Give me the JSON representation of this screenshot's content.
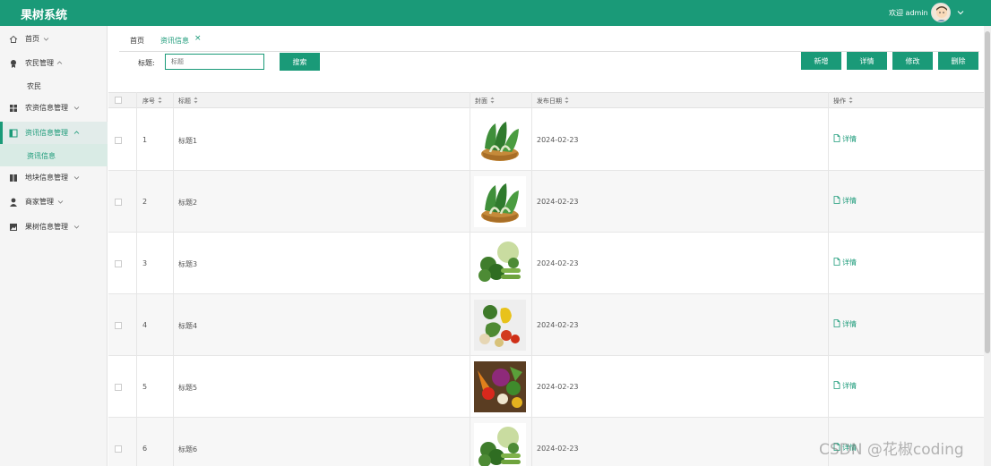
{
  "app": {
    "title": "果树系统",
    "welcome": "欢迎 admin"
  },
  "sidebar": {
    "items": [
      {
        "label": "首页",
        "icon": "home-icon"
      },
      {
        "label": "农民管理",
        "icon": "user-badge-icon"
      },
      {
        "label": "农资信息管理",
        "icon": "grid-icon"
      },
      {
        "label": "资讯信息管理",
        "icon": "panel-icon"
      },
      {
        "label": "地块信息管理",
        "icon": "columns-icon"
      },
      {
        "label": "商家管理",
        "icon": "person-icon"
      },
      {
        "label": "果树信息管理",
        "icon": "image-icon"
      }
    ],
    "sub_farmer": "农民",
    "sub_news": "资讯信息"
  },
  "tabs": {
    "home": "首页",
    "active": "资讯信息",
    "close": "×"
  },
  "search": {
    "label": "标题:",
    "placeholder": "标题",
    "button": "搜索"
  },
  "toolbar": {
    "add": "新增",
    "detail": "详情",
    "edit": "修改",
    "delete": "删除"
  },
  "table": {
    "headers": {
      "index": "序号",
      "title": "标题",
      "cover": "封面",
      "date": "发布日期",
      "action": "操作"
    },
    "rows": [
      {
        "index": "1",
        "title": "标题1",
        "date": "2024-02-23",
        "action": "详情",
        "cover": "bok-choy-basket"
      },
      {
        "index": "2",
        "title": "标题2",
        "date": "2024-02-23",
        "action": "详情",
        "cover": "bok-choy-basket"
      },
      {
        "index": "3",
        "title": "标题3",
        "date": "2024-02-23",
        "action": "详情",
        "cover": "broccoli-cabbage"
      },
      {
        "index": "4",
        "title": "标题4",
        "date": "2024-02-23",
        "action": "详情",
        "cover": "peppers-tomatoes"
      },
      {
        "index": "5",
        "title": "标题5",
        "date": "2024-02-23",
        "action": "详情",
        "cover": "vegetable-basket"
      },
      {
        "index": "6",
        "title": "标题6",
        "date": "2024-02-23",
        "action": "详情",
        "cover": "broccoli-cabbage"
      }
    ]
  },
  "watermark": "CSDN @花椒coding",
  "colors": {
    "primary": "#1a9a78",
    "sidebar_bg": "#f5f5f5",
    "active_bg": "#e2ecea"
  }
}
